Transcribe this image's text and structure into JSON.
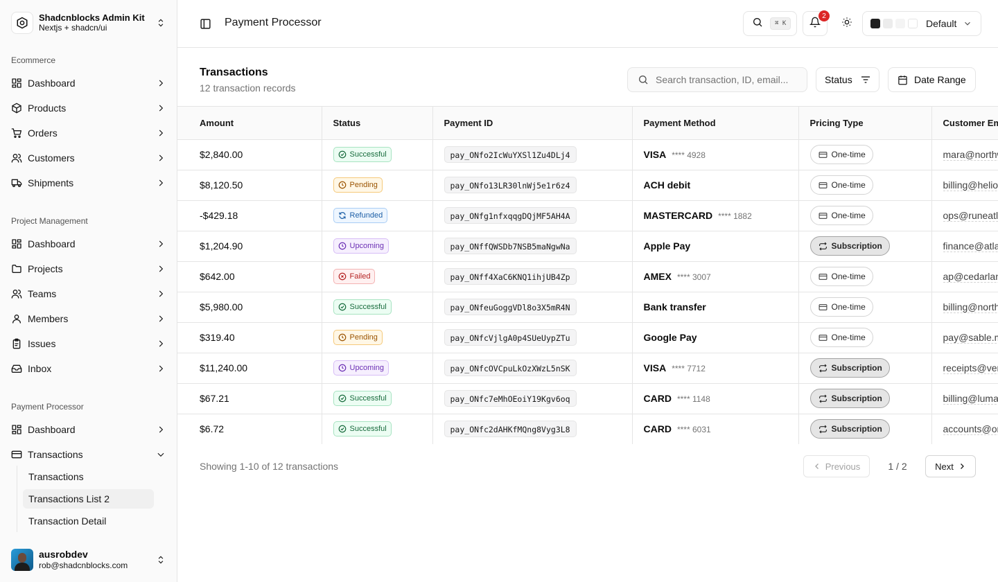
{
  "brand": {
    "title": "Shadcnblocks Admin Kit",
    "subtitle": "Nextjs + shadcn/ui"
  },
  "sidebar": {
    "groups": [
      {
        "label": "Ecommerce",
        "items": [
          {
            "label": "Dashboard",
            "icon": "dashboard-icon"
          },
          {
            "label": "Products",
            "icon": "package-icon"
          },
          {
            "label": "Orders",
            "icon": "shopping-cart-icon"
          },
          {
            "label": "Customers",
            "icon": "users-icon"
          },
          {
            "label": "Shipments",
            "icon": "truck-icon"
          }
        ]
      },
      {
        "label": "Project Management",
        "items": [
          {
            "label": "Dashboard",
            "icon": "dashboard-icon"
          },
          {
            "label": "Projects",
            "icon": "folder-icon"
          },
          {
            "label": "Teams",
            "icon": "users-icon"
          },
          {
            "label": "Members",
            "icon": "user-icon"
          },
          {
            "label": "Issues",
            "icon": "clipboard-icon"
          },
          {
            "label": "Inbox",
            "icon": "inbox-icon"
          }
        ]
      },
      {
        "label": "Payment Processor",
        "items": [
          {
            "label": "Dashboard",
            "icon": "dashboard-icon"
          },
          {
            "label": "Transactions",
            "icon": "credit-card-icon"
          }
        ]
      }
    ],
    "sub_items": [
      "Transactions",
      "Transactions List 2",
      "Transaction Detail"
    ],
    "active_sub_item": "Transactions List 2"
  },
  "user": {
    "name": "ausrobdev",
    "email": "rob@shadcnblocks.com"
  },
  "header": {
    "title": "Payment Processor",
    "search_kbd": "⌘ K",
    "notification_count": "2",
    "theme_label": "Default",
    "theme_swatches": [
      "#1f1f1f",
      "#ececec",
      "#f4f4f4",
      "#ffffff"
    ]
  },
  "section": {
    "title": "Transactions",
    "subtitle": "12 transaction records"
  },
  "toolbar": {
    "search_placeholder": "Search transaction, ID, email...",
    "status_label": "Status",
    "date_label": "Date Range"
  },
  "table": {
    "columns": [
      "Amount",
      "Status",
      "Payment ID",
      "Payment Method",
      "Pricing Type",
      "Customer Email"
    ],
    "rows": [
      {
        "amount": "$2,840.00",
        "status": "Successful",
        "payment_id": "pay_ONfo2IcWuYXSl1Zu4DLj4",
        "method": "VISA",
        "last4": "**** 4928",
        "pricing": "One-time",
        "email": "mara@northwind.io"
      },
      {
        "amount": "$8,120.50",
        "status": "Pending",
        "payment_id": "pay_ONfo13LR30lnWj5e1r6z4",
        "method": "ACH debit",
        "last4": "",
        "pricing": "One-time",
        "email": "billing@heliosgroup.com"
      },
      {
        "amount": "-$429.18",
        "status": "Refunded",
        "payment_id": "pay_ONfg1nfxqqgDQjMF5AH4A",
        "method": "MASTERCARD",
        "last4": "**** 1882",
        "pricing": "One-time",
        "email": "ops@runeatlas.dev"
      },
      {
        "amount": "$1,204.90",
        "status": "Upcoming",
        "payment_id": "pay_ONffQWSDb7NSB5maNgwNa",
        "method": "Apple Pay",
        "last4": "",
        "pricing": "Subscription",
        "email": "finance@atlasworks.co"
      },
      {
        "amount": "$642.00",
        "status": "Failed",
        "payment_id": "pay_ONff4XaC6KNQ1ihjUB4Zp",
        "method": "AMEX",
        "last4": "**** 3007",
        "pricing": "One-time",
        "email": "ap@cedarlane.io"
      },
      {
        "amount": "$5,980.00",
        "status": "Successful",
        "payment_id": "pay_ONfeuGoggVDl8o3X5mR4N",
        "method": "Bank transfer",
        "last4": "",
        "pricing": "One-time",
        "email": "billing@northpeak.com"
      },
      {
        "amount": "$319.40",
        "status": "Pending",
        "payment_id": "pay_ONfcVjlgA0p4SUeUypZTu",
        "method": "Google Pay",
        "last4": "",
        "pricing": "One-time",
        "email": "pay@sable.mx"
      },
      {
        "amount": "$11,240.00",
        "status": "Upcoming",
        "payment_id": "pay_ONfcOVCpuLkOzXWzL5nSK",
        "method": "VISA",
        "last4": "**** 7712",
        "pricing": "Subscription",
        "email": "receipts@vertex.ai"
      },
      {
        "amount": "$67.21",
        "status": "Successful",
        "payment_id": "pay_ONfc7eMhOEoiY19Kgv6oq",
        "method": "CARD",
        "last4": "**** 1148",
        "pricing": "Subscription",
        "email": "billing@lumanova.com"
      },
      {
        "amount": "$6.72",
        "status": "Successful",
        "payment_id": "pay_ONfc2dAHKfMQng8Vyg3L8",
        "method": "CARD",
        "last4": "**** 6031",
        "pricing": "Subscription",
        "email": "accounts@orbit.so"
      }
    ]
  },
  "pagination": {
    "showing": "Showing 1-10 of 12 transactions",
    "prev_label": "Previous",
    "page_indicator": "1 / 2",
    "next_label": "Next"
  }
}
